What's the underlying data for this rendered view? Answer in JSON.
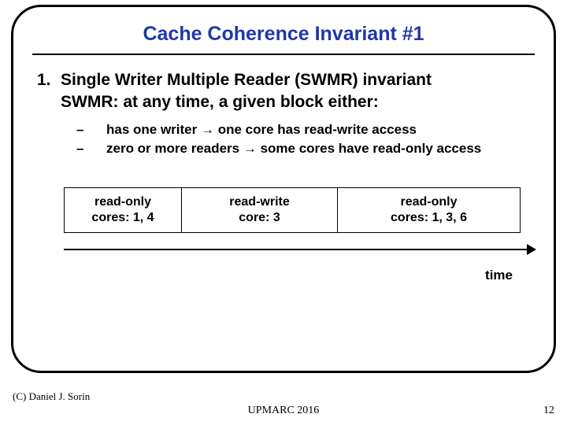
{
  "title": "Cache Coherence Invariant #1",
  "list": {
    "num": "1.",
    "line1": "Single Writer Multiple Reader (SWMR) invariant",
    "line2": "SWMR: at any time, a given block either:",
    "dash": "–",
    "bullet1_a": "has one writer ",
    "bullet1_b": " one core has read-write access",
    "bullet2_a": "zero or more readers ",
    "bullet2_b": " some cores have read-only access",
    "arrow": "→"
  },
  "epochs": {
    "e1_l1": "read-only",
    "e1_l2": "cores: 1, 4",
    "e2_l1": "read-write",
    "e2_l2": "core: 3",
    "e3_l1": "read-only",
    "e3_l2": "cores: 1, 3, 6"
  },
  "time_label": "time",
  "copyright": "(C) Daniel J. Sorin",
  "footer": "UPMARC 2016",
  "page": "12"
}
